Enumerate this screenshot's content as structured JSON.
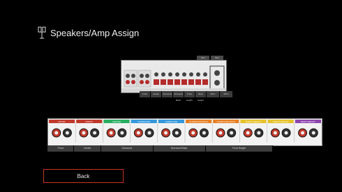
{
  "header": {
    "title": "Speakers/Amp Assign",
    "icon": "speaker-config-icon"
  },
  "pre_out": {
    "tabs": [
      "SW 1",
      "SW 2"
    ],
    "labels": [
      "Front",
      "Center",
      "Surround",
      "Surround Back",
      "Front Height",
      "Rear Height",
      "SW 1",
      "SW 2"
    ],
    "section_label": "PRE OUT"
  },
  "terminals": {
    "sections": [
      {
        "label": "FRONT",
        "color": "#c0392b"
      },
      {
        "label": "FRONT",
        "color": "#c0392b"
      },
      {
        "label": "CENTER",
        "color": "#27ae60"
      },
      {
        "label": "SURROUND",
        "color": "#3498db"
      },
      {
        "label": "SURROUND",
        "color": "#3498db"
      },
      {
        "label": "SURROUND BACK",
        "color": "#e67e22"
      },
      {
        "label": "SURROUND BACK",
        "color": "#e67e22"
      },
      {
        "label": "FRONT HEIGHT",
        "color": "#e6c229"
      },
      {
        "label": "FRONT HEIGHT",
        "color": "#e6c229"
      },
      {
        "label": "REAR HEIGHT",
        "color": "#8e44ad"
      }
    ],
    "bottom_labels": [
      "Front",
      "Center",
      "Surround",
      "Surround Back",
      "Front Height"
    ]
  },
  "back_button": {
    "label": "Back"
  }
}
